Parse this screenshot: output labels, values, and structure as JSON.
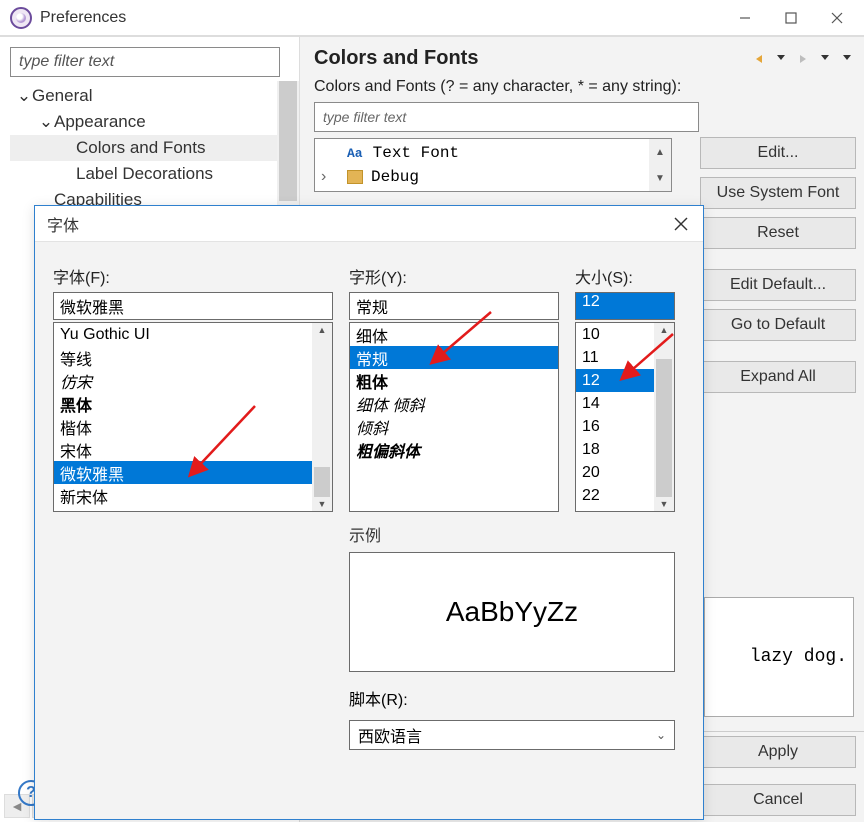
{
  "window": {
    "title": "Preferences"
  },
  "left": {
    "filter_placeholder": "type filter text",
    "tree": {
      "general": "General",
      "appearance": "Appearance",
      "colors_fonts": "Colors and Fonts",
      "label_decorations": "Label Decorations",
      "capabilities": "Capabilities"
    }
  },
  "right": {
    "heading": "Colors and Fonts",
    "hint": "Colors and Fonts (? = any character, * = any string):",
    "filter_placeholder": "type filter text",
    "font_tree": {
      "aa": "Aa",
      "text_font": "Text Font",
      "debug": "Debug"
    },
    "buttons": {
      "edit": "Edit...",
      "use_system": "Use System Font",
      "reset": "Reset",
      "edit_default": "Edit Default...",
      "go_default": "Go to Default",
      "expand_all": "Expand All",
      "apply": "Apply",
      "cancel": "Cancel"
    },
    "preview_fragment": "lazy dog."
  },
  "font_dialog": {
    "title": "字体",
    "font_label": "字体(F):",
    "style_label": "字形(Y):",
    "size_label": "大小(S):",
    "font_value": "微软雅黑",
    "style_value": "常规",
    "size_value": "12",
    "fonts": [
      "Yu Gothic UI",
      "等线",
      "仿宋",
      "黑体",
      "楷体",
      "宋体",
      "微软雅黑",
      "新宋体"
    ],
    "font_selected": "微软雅黑",
    "styles": [
      "细体",
      "常规",
      "粗体",
      "细体 倾斜",
      "倾斜",
      "粗偏斜体"
    ],
    "style_selected": "常规",
    "sizes": [
      "10",
      "11",
      "12",
      "14",
      "16",
      "18",
      "20",
      "22"
    ],
    "size_selected": "12",
    "sample_label": "示例",
    "sample_text": "AaBbYyZz",
    "script_label": "脚本(R):",
    "script_value": "西欧语言"
  }
}
